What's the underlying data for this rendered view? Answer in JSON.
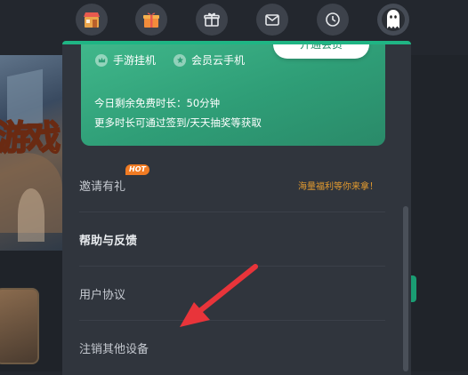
{
  "vip": {
    "feature1": "手游挂机",
    "feature2": "会员云手机",
    "open_button": "开通会员",
    "remaining": "今日剩余免费时长：50分钟",
    "more_time": "更多时长可通过签到/天天抽奖等获取"
  },
  "menu": {
    "invite": "邀请有礼",
    "hot_badge": "HOT",
    "invite_promo": "海量福利等你来拿！",
    "help": "帮助与反馈",
    "agreement": "用户协议",
    "logout_devices": "注销其他设备"
  },
  "background": {
    "art_text": "游戏"
  },
  "colors": {
    "accent_green": "#1fb584",
    "promo_orange": "#e29a2f",
    "annotation_red": "#e8343a"
  }
}
